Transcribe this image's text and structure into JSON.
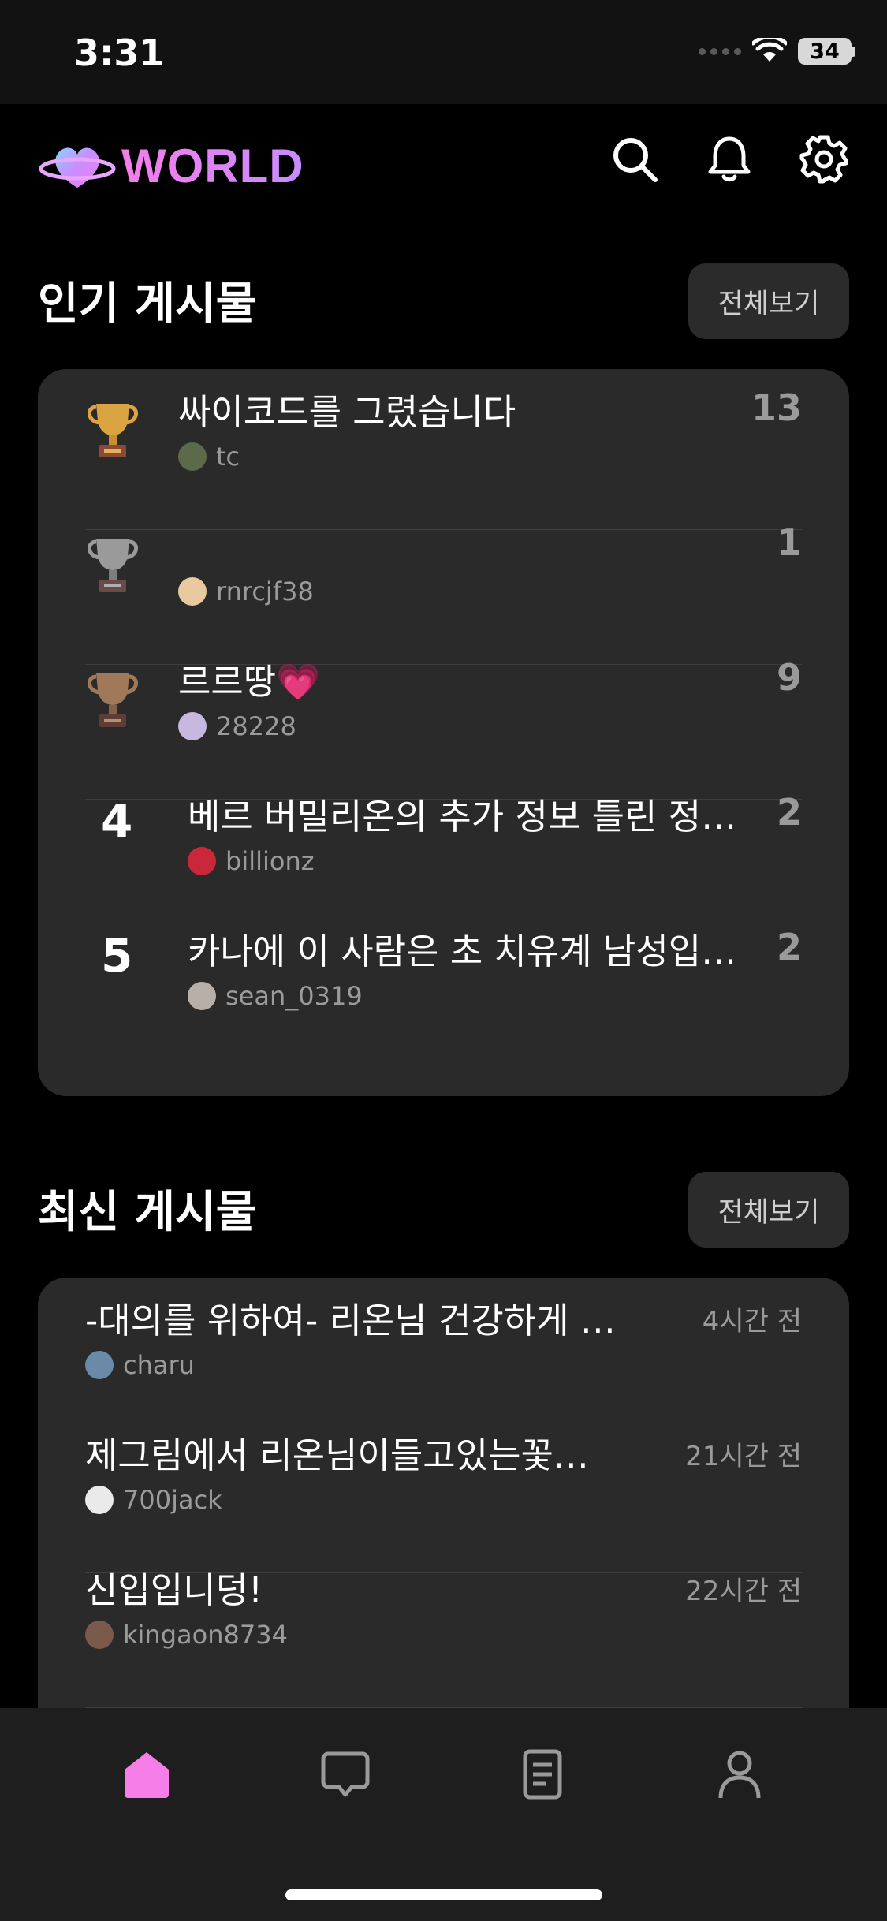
{
  "status_bar": {
    "time": "3:31",
    "battery": "34"
  },
  "header": {
    "logo_text": "WORLD",
    "icons": [
      "search-icon",
      "bell-icon",
      "gear-icon"
    ]
  },
  "popular": {
    "title": "인기 게시물",
    "see_all": "전체보기",
    "posts": [
      {
        "rank": "1",
        "rank_icon": "gold-trophy-icon",
        "title": "싸이코드를 그렸습니다",
        "author": "tc",
        "count": "13"
      },
      {
        "rank": "2",
        "rank_icon": "silver-trophy-icon",
        "title": "",
        "author": "rnrcjf38",
        "count": "1"
      },
      {
        "rank": "3",
        "rank_icon": "bronze-trophy-icon",
        "title": "르르땅💗",
        "author": "28228",
        "count": "9"
      },
      {
        "rank": "4",
        "title": "베르 버밀리온의 추가 정보 틀린 정…",
        "author": "billionz",
        "count": "2"
      },
      {
        "rank": "5",
        "title": "카나에 이 사람은 초 치유계 남성입…",
        "author": "sean_0319",
        "count": "2"
      }
    ]
  },
  "recent": {
    "title": "최신 게시물",
    "see_all": "전체보기",
    "posts": [
      {
        "title": "-대의를 위하여- 리온님 건강하게 …",
        "author": "charu",
        "time": "4시간 전"
      },
      {
        "title": "제그림에서 리온님이들고있는꽃…",
        "author": "700jack",
        "time": "21시간 전"
      },
      {
        "title": "신입입니덩!",
        "author": "kingaon8734",
        "time": "22시간 전"
      }
    ]
  },
  "colors": {
    "accent": "#f57ee8",
    "card": "#2a2a2a",
    "gold": "#d9a441",
    "silver": "#9a9a9a",
    "bronze": "#a0785a"
  },
  "bottom_nav": [
    "home-icon",
    "chat-icon",
    "document-icon",
    "profile-icon"
  ]
}
